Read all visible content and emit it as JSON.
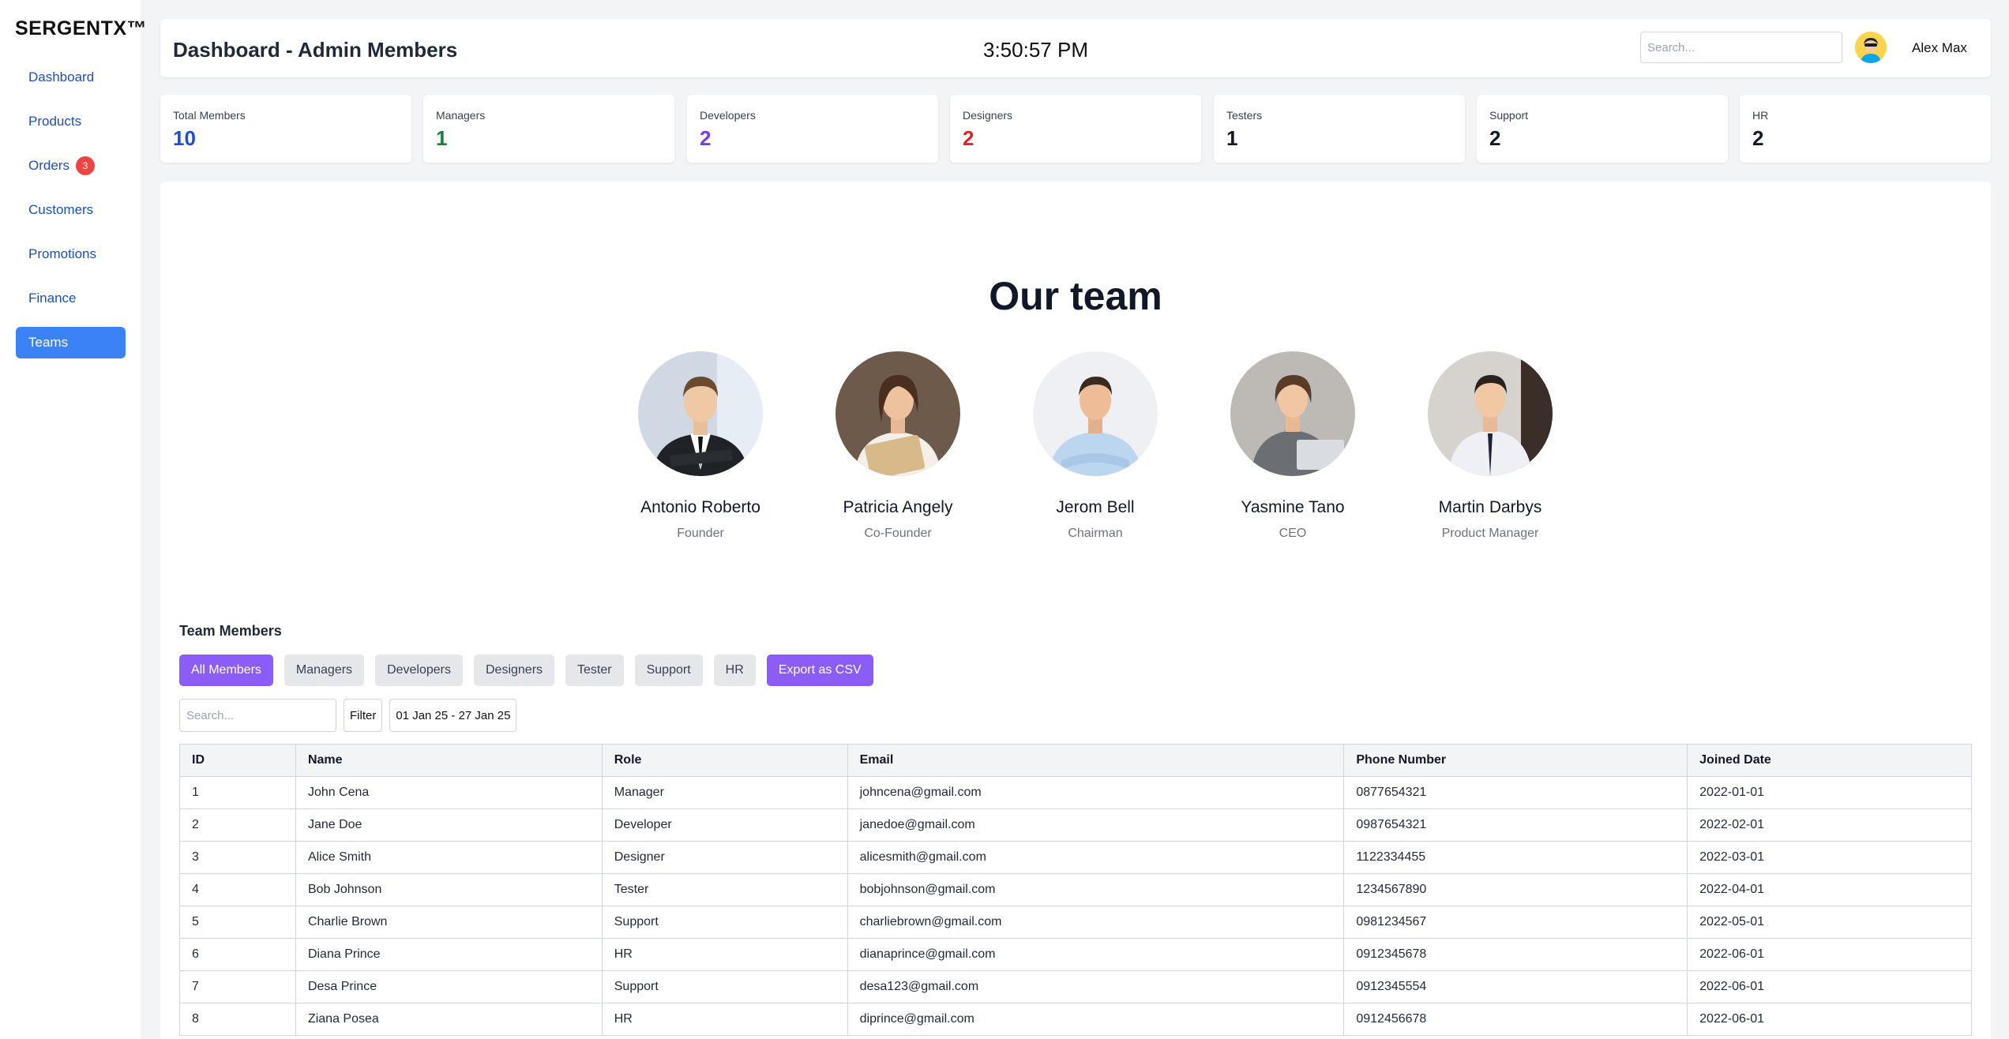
{
  "brand": "SERGENTX™",
  "sidebar": {
    "items": [
      {
        "label": "Dashboard"
      },
      {
        "label": "Products"
      },
      {
        "label": "Orders",
        "badge": "3"
      },
      {
        "label": "Customers"
      },
      {
        "label": "Promotions"
      },
      {
        "label": "Finance"
      },
      {
        "label": "Teams",
        "active": true
      }
    ]
  },
  "header": {
    "title": "Dashboard - Admin Members",
    "clock": "3:50:57 PM",
    "search_placeholder": "Search...",
    "user_name": "Alex Max"
  },
  "stats": [
    {
      "label": "Total Members",
      "value": "10",
      "color": "#1d4ed8"
    },
    {
      "label": "Managers",
      "value": "1",
      "color": "#15803d"
    },
    {
      "label": "Developers",
      "value": "2",
      "color": "#7c3aed"
    },
    {
      "label": "Designers",
      "value": "2",
      "color": "#dc2626"
    },
    {
      "label": "Testers",
      "value": "1",
      "color": "#111827"
    },
    {
      "label": "Support",
      "value": "2",
      "color": "#111827"
    },
    {
      "label": "HR",
      "value": "2",
      "color": "#111827"
    }
  ],
  "team": {
    "heading": "Our team",
    "members": [
      {
        "name": "Antonio Roberto",
        "title": "Founder"
      },
      {
        "name": "Patricia Angely",
        "title": "Co-Founder"
      },
      {
        "name": "Jerom Bell",
        "title": "Chairman"
      },
      {
        "name": "Yasmine Tano",
        "title": "CEO"
      },
      {
        "name": "Martin Darbys",
        "title": "Product Manager"
      }
    ]
  },
  "members_section": {
    "title": "Team Members",
    "filters": [
      "All Members",
      "Managers",
      "Developers",
      "Designers",
      "Tester",
      "Support",
      "HR"
    ],
    "export_label": "Export as CSV",
    "search_placeholder": "Search...",
    "filter_label": "Filter",
    "date_range": "01 Jan 25 - 27 Jan 25"
  },
  "table": {
    "columns": [
      "ID",
      "Name",
      "Role",
      "Email",
      "Phone Number",
      "Joined Date"
    ],
    "rows": [
      [
        "1",
        "John Cena",
        "Manager",
        "johncena@gmail.com",
        "0877654321",
        "2022-01-01"
      ],
      [
        "2",
        "Jane Doe",
        "Developer",
        "janedoe@gmail.com",
        "0987654321",
        "2022-02-01"
      ],
      [
        "3",
        "Alice Smith",
        "Designer",
        "alicesmith@gmail.com",
        "1122334455",
        "2022-03-01"
      ],
      [
        "4",
        "Bob Johnson",
        "Tester",
        "bobjohnson@gmail.com",
        "1234567890",
        "2022-04-01"
      ],
      [
        "5",
        "Charlie Brown",
        "Support",
        "charliebrown@gmail.com",
        "0981234567",
        "2022-05-01"
      ],
      [
        "6",
        "Diana Prince",
        "HR",
        "dianaprince@gmail.com",
        "0912345678",
        "2022-06-01"
      ],
      [
        "7",
        "Desa Prince",
        "Support",
        "desa123@gmail.com",
        "0912345554",
        "2022-06-01"
      ],
      [
        "8",
        "Ziana Posea",
        "HR",
        "diprince@gmail.com",
        "0912456678",
        "2022-06-01"
      ]
    ]
  }
}
